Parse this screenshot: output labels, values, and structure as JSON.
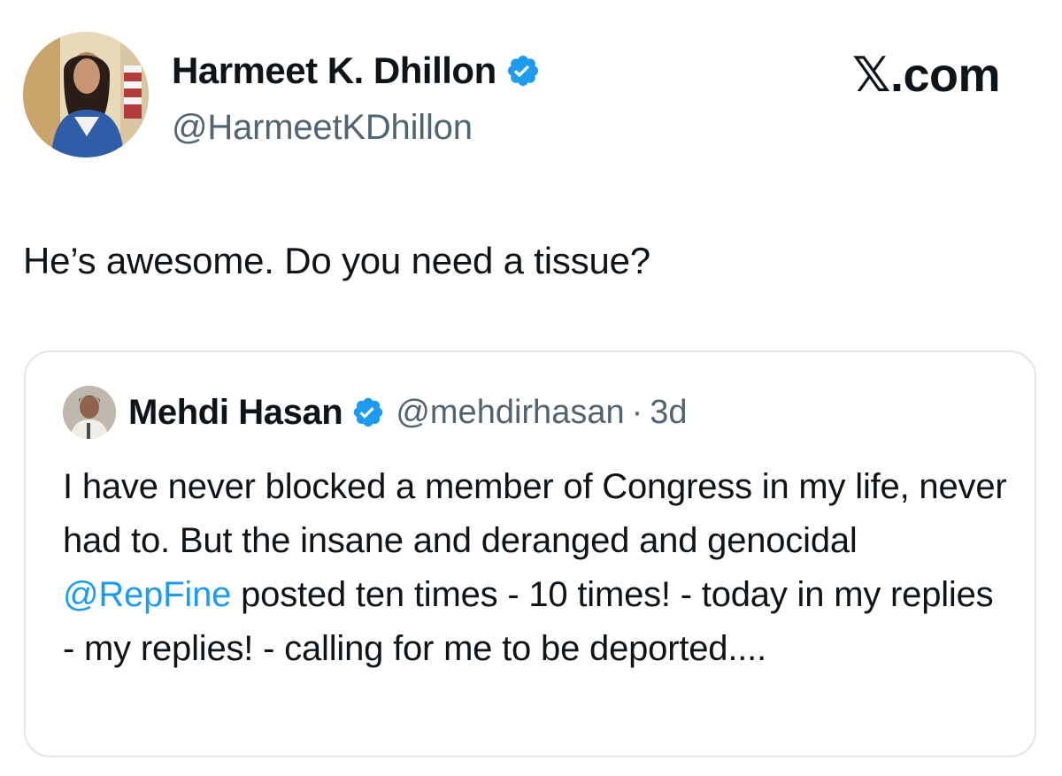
{
  "tweet": {
    "author": {
      "name": "Harmeet K. Dhillon",
      "handle": "@HarmeetKDhillon",
      "verified": true,
      "avatar_icon": "profile-photo"
    },
    "site_logo": "𝕏.com",
    "text": "He’s awesome. Do you need a tissue?"
  },
  "quoted_tweet": {
    "author": {
      "name": "Mehdi Hasan",
      "handle": "@mehdirhasan",
      "verified": true,
      "avatar_icon": "profile-photo"
    },
    "separator": "·",
    "time": "3d",
    "text_before_mention": "I have never blocked a member of Congress in my life, never had to. But the insane and deranged and genocidal ",
    "mention": "@RepFine",
    "text_after_mention": " posted ten times - 10 times! - today in my replies - my replies! - calling for me to be deported...."
  },
  "colors": {
    "verified_badge": "#1d9bf0",
    "mention_link": "#1d9bf0",
    "secondary_text": "#536471",
    "primary_text": "#0f1419",
    "card_border": "#e1e6ea"
  }
}
